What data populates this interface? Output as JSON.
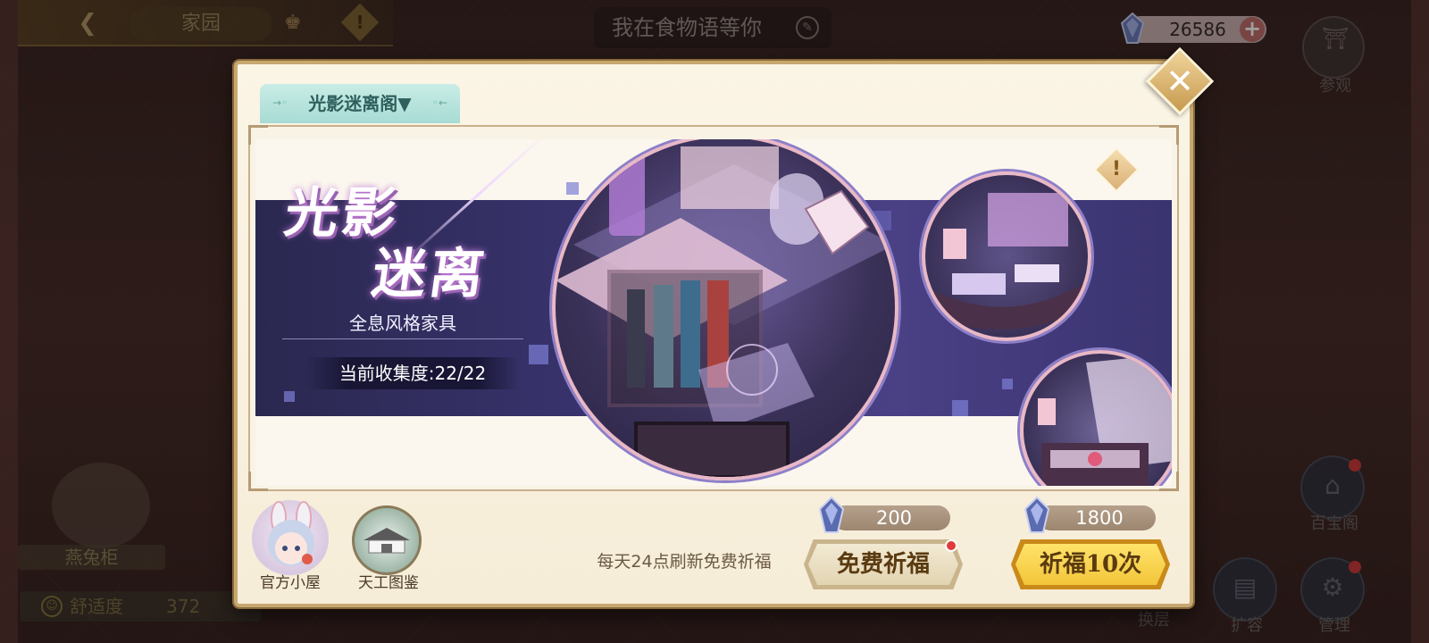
{
  "header": {
    "home_label": "家园",
    "chat_placeholder": "我在食物语等你",
    "currency_value": "26586",
    "visit_label": "参观"
  },
  "side": {
    "shop_label": "百宝阁",
    "floor_label": "换层",
    "expand_label": "扩容",
    "manage_label": "管理",
    "pet_label": "燕兔柜",
    "comfort_label": "舒适度",
    "comfort_value": "372"
  },
  "modal": {
    "tab_label": "光影迷离阁▼",
    "title_line1": "光影",
    "title_line2": "迷离",
    "subtitle": "全息风格家具",
    "collection": "当前收集度:22/22",
    "official_house_label": "官方小屋",
    "catalog_label": "天工图鉴",
    "refresh_note": "每天24点刷新免费祈福",
    "free_cost": "200",
    "ten_cost": "1800",
    "free_pray_label": "免费祈福",
    "ten_pray_label": "祈福10次"
  },
  "colors": {
    "modal_bg": "#fbf5e6",
    "banner_band": "#3a3470",
    "gold_button": "#f3c53a",
    "beige_button": "#e8dcc0",
    "tab_teal": "#a7dcd4",
    "notice_red": "#e23b3b"
  }
}
